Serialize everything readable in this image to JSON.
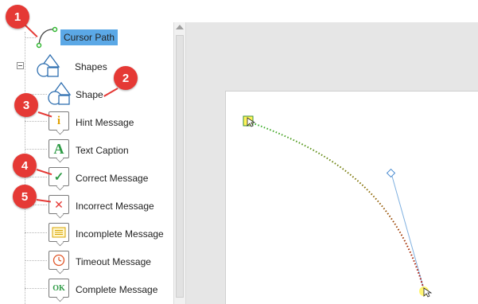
{
  "timeline_tree": {
    "items": [
      {
        "label": "Cursor Path",
        "icon": "cursor-path-icon",
        "selected": true
      },
      {
        "label": "Shapes",
        "icon": "shapes-group-icon"
      },
      {
        "label": "Shape",
        "icon": "shape-icon"
      },
      {
        "label": "Hint Message",
        "icon": "hint-message-icon"
      },
      {
        "label": "Text Caption",
        "icon": "text-caption-icon"
      },
      {
        "label": "Correct Message",
        "icon": "correct-message-icon"
      },
      {
        "label": "Incorrect Message",
        "icon": "incorrect-message-icon"
      },
      {
        "label": "Incomplete Message",
        "icon": "incomplete-message-icon"
      },
      {
        "label": "Timeout Message",
        "icon": "timeout-message-icon"
      },
      {
        "label": "Complete Message",
        "icon": "complete-message-icon"
      }
    ],
    "glyphs": {
      "hint": "i",
      "text_caption": "A",
      "correct": "✓",
      "incorrect": "✕",
      "complete": "OK"
    }
  },
  "callouts": [
    "1",
    "2",
    "3",
    "4",
    "5"
  ],
  "colors": {
    "selection": "#5ba8e6",
    "badge": "#e53935",
    "path_start": "#2db52d",
    "path_end": "#b20000",
    "tangent": "#7fb0e0"
  }
}
